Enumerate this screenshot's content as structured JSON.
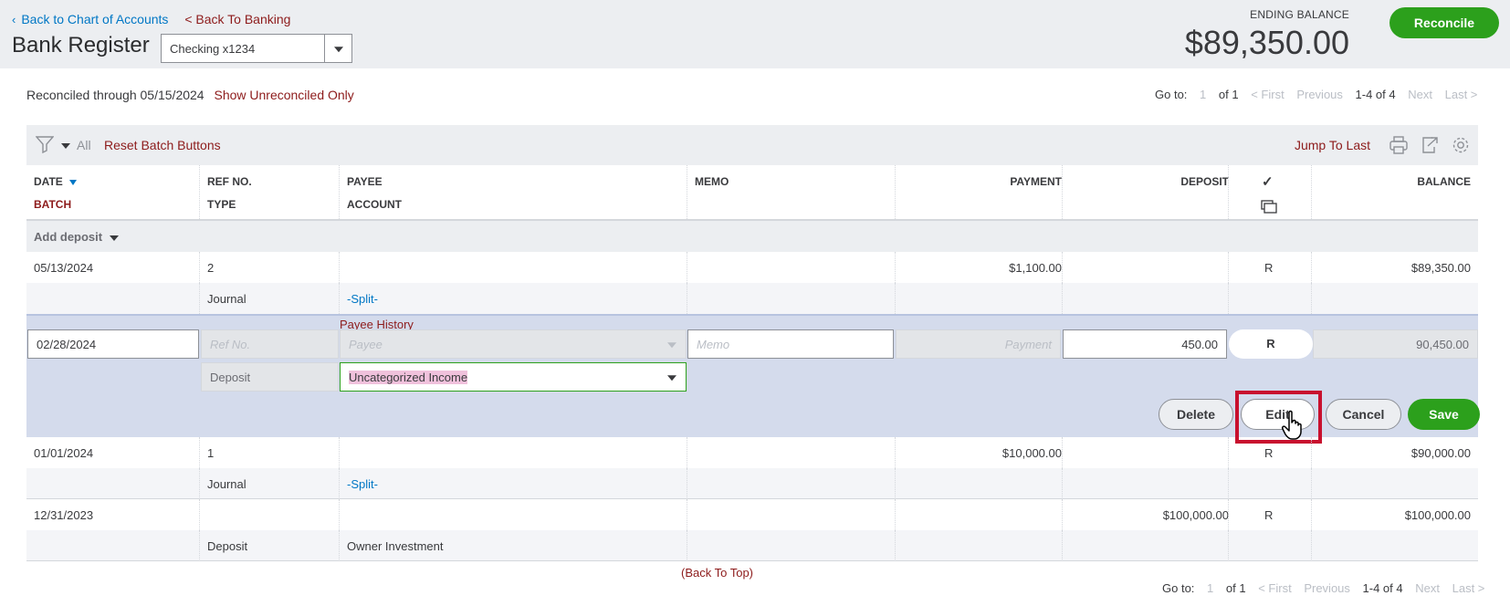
{
  "header": {
    "back_chart": "Back to Chart of Accounts",
    "back_banking": "< Back To Banking",
    "title": "Bank Register",
    "account_selected": "Checking x1234",
    "ending_balance_label": "ENDING BALANCE",
    "ending_balance": "$89,350.00",
    "reconcile_label": "Reconcile"
  },
  "subbar": {
    "reconciled": "Reconciled through 05/15/2024",
    "show_unreconciled": "Show Unreconciled Only"
  },
  "pager": {
    "goto": "Go to:",
    "page": "1",
    "of": "of 1",
    "first": "< First",
    "previous": "Previous",
    "range": "1-4 of 4",
    "next": "Next",
    "last": "Last >"
  },
  "toolbar": {
    "all": "All",
    "reset": "Reset Batch Buttons",
    "jump": "Jump To Last"
  },
  "columns": {
    "date": "DATE",
    "batch": "BATCH",
    "refno": "REF NO.",
    "type": "TYPE",
    "payee": "PAYEE",
    "account": "ACCOUNT",
    "memo": "MEMO",
    "payment": "PAYMENT",
    "deposit": "DEPOSIT",
    "check": "✓",
    "balance": "BALANCE"
  },
  "add_deposit": "Add deposit",
  "rows": [
    {
      "date": "05/13/2024",
      "ref": "2",
      "type": "Journal",
      "account": "-Split-",
      "payment": "$1,100.00",
      "deposit": "",
      "status": "R",
      "balance": "$89,350.00"
    },
    {
      "date": "01/01/2024",
      "ref": "1",
      "type": "Journal",
      "account": "-Split-",
      "payment": "$10,000.00",
      "deposit": "",
      "status": "R",
      "balance": "$90,000.00"
    },
    {
      "date": "12/31/2023",
      "ref": "",
      "type": "Deposit",
      "account": "Owner Investment",
      "payment": "",
      "deposit": "$100,000.00",
      "status": "R",
      "balance": "$100,000.00"
    }
  ],
  "edit_row": {
    "payee_history": "Payee History",
    "date": "02/28/2024",
    "ref_placeholder": "Ref No.",
    "payee_placeholder": "Payee",
    "memo_placeholder": "Memo",
    "payment_placeholder": "Payment",
    "deposit": "450.00",
    "status": "R",
    "balance": "90,450.00",
    "type": "Deposit",
    "account": "Uncategorized Income",
    "delete": "Delete",
    "edit": "Edit",
    "cancel": "Cancel",
    "save": "Save"
  },
  "back_to_top": "(Back To Top)",
  "icons": {
    "funnel": "filter-icon",
    "print": "print-icon",
    "export": "export-icon",
    "settings": "gear-icon",
    "copy": "copy-icon",
    "cursor": "hand-pointer-icon"
  }
}
